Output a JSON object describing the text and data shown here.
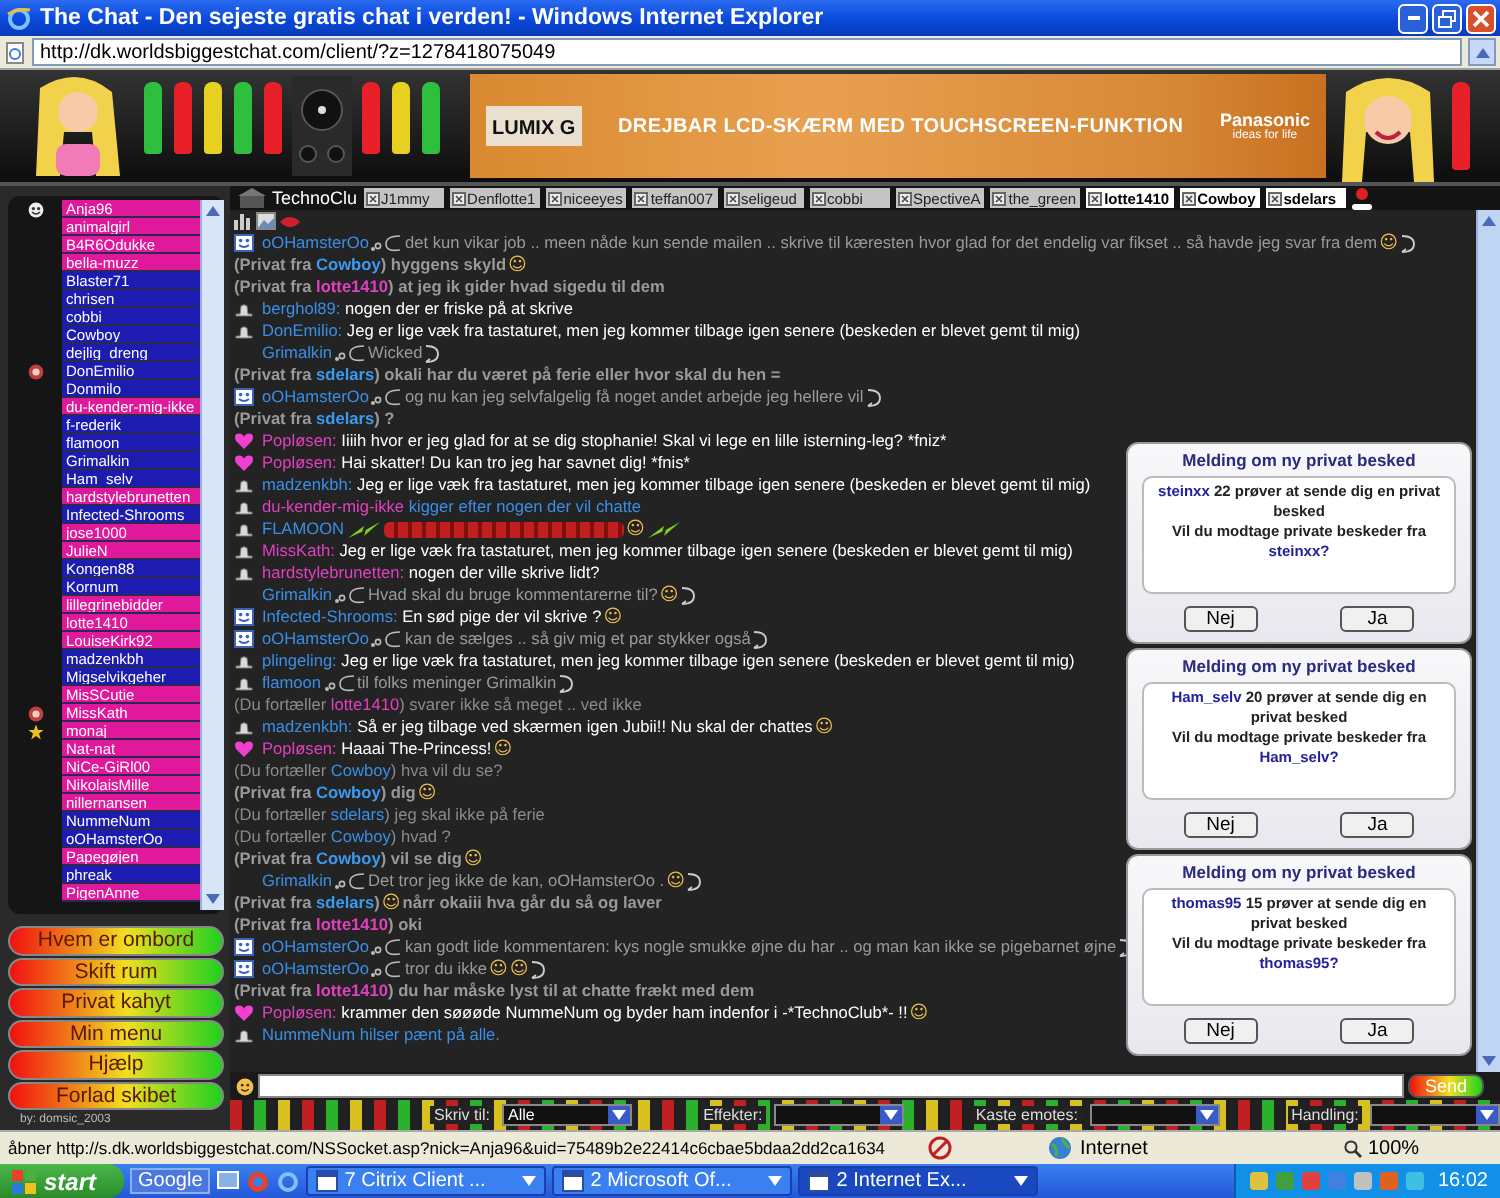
{
  "window": {
    "title": "The Chat - Den sejeste gratis chat i verden! - Windows Internet Explorer"
  },
  "address_bar": {
    "url": "http://dk.worldsbiggestchat.com/client/?z=1278418075049"
  },
  "banner": {
    "ad_brand": "LUMIX G",
    "ad_text": "DREJBAR LCD-SKÆRM MED TOUCHSCREEN-FUNKTION",
    "ad_maker": "Panasonic",
    "ad_slogan": "ideas for life"
  },
  "users": [
    {
      "name": "Anja96",
      "color": "#e0189c",
      "kind": "self"
    },
    {
      "name": "animalgirl",
      "color": "#e0189c",
      "kind": "plain"
    },
    {
      "name": "B4R6Odukke",
      "color": "#e0189c",
      "kind": "plain"
    },
    {
      "name": "bella-muzz",
      "color": "#e0189c",
      "kind": "plain"
    },
    {
      "name": "Blaster71",
      "color": "#1c1cb0",
      "kind": "plain"
    },
    {
      "name": "chrisen",
      "color": "#1c1cb0",
      "kind": "plain"
    },
    {
      "name": "cobbi",
      "color": "#1c1cb0",
      "kind": "plain"
    },
    {
      "name": "Cowboy",
      "color": "#1c1cb0",
      "kind": "plain"
    },
    {
      "name": "dejlig_dreng",
      "color": "#1c1cb0",
      "kind": "plain"
    },
    {
      "name": "DonEmilio",
      "color": "#1c1cb0",
      "kind": "face"
    },
    {
      "name": "Donmilo",
      "color": "#1c1cb0",
      "kind": "plain"
    },
    {
      "name": "du-kender-mig-ikke",
      "color": "#e0189c",
      "kind": "plain"
    },
    {
      "name": "f-rederik",
      "color": "#1c1cb0",
      "kind": "plain"
    },
    {
      "name": "flamoon",
      "color": "#1c1cb0",
      "kind": "plain"
    },
    {
      "name": "Grimalkin",
      "color": "#1c1cb0",
      "kind": "plain"
    },
    {
      "name": "Ham_selv",
      "color": "#1c1cb0",
      "kind": "plain"
    },
    {
      "name": "hardstylebrunetten",
      "color": "#e0189c",
      "kind": "plain"
    },
    {
      "name": "Infected-Shrooms",
      "color": "#1c1cb0",
      "kind": "plain"
    },
    {
      "name": "jose1000",
      "color": "#e0189c",
      "kind": "plain"
    },
    {
      "name": "JulieN",
      "color": "#e0189c",
      "kind": "plain"
    },
    {
      "name": "Kongen88",
      "color": "#1c1cb0",
      "kind": "plain"
    },
    {
      "name": "Kornum",
      "color": "#1c1cb0",
      "kind": "plain"
    },
    {
      "name": "lillegrinebidder",
      "color": "#e0189c",
      "kind": "plain"
    },
    {
      "name": "lotte1410",
      "color": "#e0189c",
      "kind": "plain"
    },
    {
      "name": "LouiseKirk92",
      "color": "#e0189c",
      "kind": "plain"
    },
    {
      "name": "madzenkbh",
      "color": "#1c1cb0",
      "kind": "plain"
    },
    {
      "name": "Migselvikgeher",
      "color": "#1c1cb0",
      "kind": "plain"
    },
    {
      "name": "MisSCutie",
      "color": "#e0189c",
      "kind": "plain"
    },
    {
      "name": "MissKath",
      "color": "#e0189c",
      "kind": "face"
    },
    {
      "name": "monaj",
      "color": "#e0189c",
      "kind": "star"
    },
    {
      "name": "Nat-nat",
      "color": "#e0189c",
      "kind": "plain"
    },
    {
      "name": "NiCe-GiRl00",
      "color": "#e0189c",
      "kind": "plain"
    },
    {
      "name": "NikolaisMille",
      "color": "#e0189c",
      "kind": "plain"
    },
    {
      "name": "nillernansen",
      "color": "#e0189c",
      "kind": "plain"
    },
    {
      "name": "NummeNum",
      "color": "#1c1cb0",
      "kind": "plain"
    },
    {
      "name": "oOHamsterOo",
      "color": "#1c1cb0",
      "kind": "plain"
    },
    {
      "name": "Papegøjen",
      "color": "#e0189c",
      "kind": "plain"
    },
    {
      "name": "phreak",
      "color": "#1c1cb0",
      "kind": "plain"
    },
    {
      "name": "PigenAnne",
      "color": "#e0189c",
      "kind": "plain"
    }
  ],
  "menu_buttons": [
    "Hvem er ombord",
    "Skift rum",
    "Privat kahyt",
    "Min menu",
    "Hjælp",
    "Forlad skibet"
  ],
  "credit": "by: domsic_2003",
  "tabs": {
    "room": "TechnoClu",
    "items": [
      {
        "label": "J1mmy",
        "highlighted": false
      },
      {
        "label": "Denflotte1",
        "highlighted": false
      },
      {
        "label": "niceeyes",
        "highlighted": false
      },
      {
        "label": "teffan007",
        "highlighted": false
      },
      {
        "label": "seligeud",
        "highlighted": false
      },
      {
        "label": "cobbi",
        "highlighted": false
      },
      {
        "label": "SpectiveA",
        "highlighted": false
      },
      {
        "label": "the_green",
        "highlighted": false
      },
      {
        "label": "lotte1410",
        "highlighted": true
      },
      {
        "label": "Cowboy",
        "highlighted": true
      },
      {
        "label": "sdelars",
        "highlighted": true
      }
    ]
  },
  "messages": [
    {
      "kind": "action",
      "vip": true,
      "name": "oOHamsterOo",
      "color": "#3a8ee6",
      "text": "det kun vikar job .. meen nåde kun sende mailen .. skrive til kæresten hvor glad for det endelig var fikset .. så havde jeg svar fra dem",
      "emotes": [
        "☺"
      ]
    },
    {
      "kind": "private",
      "before": "(Privat fra ",
      "name": "Cowboy",
      "color": "#3a9af0",
      "after": ") hyggens skyld",
      "emotes": [
        "☺"
      ]
    },
    {
      "kind": "private",
      "before": "(Privat fra ",
      "name": "lotte1410",
      "color": "#e040c0",
      "after": ") at jeg ik gider hvad sigedu til dem"
    },
    {
      "kind": "public",
      "member": true,
      "name": "berghol89:",
      "color": "#3a8ee6",
      "text": " nogen der er friske på at skrive"
    },
    {
      "kind": "public",
      "member": true,
      "name": "DonEmilio:",
      "color": "#3a8ee6",
      "text": " Jeg er lige væk fra tastaturet, men jeg kommer tilbage igen senere (beskeden er blevet gemt til mig)"
    },
    {
      "kind": "action",
      "name": "Grimalkin",
      "color": "#3a8ee6",
      "text": "Wicked"
    },
    {
      "kind": "private",
      "before": "(Privat fra ",
      "name": "sdelars",
      "color": "#3a9af0",
      "after": ") okali har du været på ferie eller hvor skal du hen ="
    },
    {
      "kind": "action",
      "vip": true,
      "name": "oOHamsterOo",
      "color": "#3a8ee6",
      "text": "og nu kan jeg selvfalgelig få noget andet arbejde jeg hellere vil"
    },
    {
      "kind": "private",
      "before": "(Privat fra ",
      "name": "sdelars",
      "color": "#3a9af0",
      "after": ") ?"
    },
    {
      "kind": "public",
      "favorite": true,
      "name": "Popløsen:",
      "color": "#e040c0",
      "text": " Iiiih hvor er jeg glad for at se dig stophanie! Skal vi lege en lille isterning-leg? *fniz*"
    },
    {
      "kind": "public",
      "favorite": true,
      "name": "Popløsen:",
      "color": "#e040c0",
      "text": " Hai skatter! Du kan tro jeg har savnet dig! *fnis*"
    },
    {
      "kind": "public",
      "member": true,
      "name": "madzenkbh:",
      "color": "#3a8ee6",
      "text": " Jeg er lige væk fra tastaturet, men jeg kommer tilbage igen senere (beskeden er blevet gemt til mig)"
    },
    {
      "kind": "status",
      "member": true,
      "name": "du-kender-mig-ikke",
      "color": "#e040c0",
      "text": " kigger efter nogen der vil chatte"
    },
    {
      "kind": "effect",
      "member": true,
      "name": "FLAMOON",
      "color": "#3a8ee6",
      "emotes": [
        "☺"
      ]
    },
    {
      "kind": "public",
      "member": true,
      "name": "MissKath:",
      "color": "#e040c0",
      "text": " Jeg er lige væk fra tastaturet, men jeg kommer tilbage igen senere (beskeden er blevet gemt til mig)"
    },
    {
      "kind": "public",
      "member": true,
      "name": "hardstylebrunetten:",
      "color": "#e040c0",
      "text": " nogen der ville skrive lidt?"
    },
    {
      "kind": "action",
      "name": "Grimalkin",
      "color": "#3a8ee6",
      "text": "Hvad skal du bruge kommentarerne til?",
      "emotes": [
        "☺"
      ]
    },
    {
      "kind": "public",
      "vip": true,
      "name": "Infected-Shrooms:",
      "color": "#3a8ee6",
      "text": " En sød pige der vil skrive ?",
      "emotes": [
        "☺"
      ]
    },
    {
      "kind": "action",
      "vip": true,
      "name": "oOHamsterOo",
      "color": "#3a8ee6",
      "text": "kan de sælges .. så giv mig et par stykker også"
    },
    {
      "kind": "public",
      "member": true,
      "name": "plingeling:",
      "color": "#3a8ee6",
      "text": " Jeg er lige væk fra tastaturet, men jeg kommer tilbage igen senere (beskeden er blevet gemt til mig)"
    },
    {
      "kind": "action",
      "member": true,
      "name": "flamoon",
      "color": "#3a8ee6",
      "text": "til folks meninger Grimalkin"
    },
    {
      "kind": "told",
      "before": "(Du fortæller ",
      "name": "lotte1410",
      "color": "#e040c0",
      "after": ") svarer ikke så meget .. ved ikke"
    },
    {
      "kind": "public",
      "member": true,
      "name": "madzenkbh:",
      "color": "#3a8ee6",
      "text": " Så er jeg tilbage ved skærmen igen Jubii!! Nu skal der chattes",
      "emotes": [
        "☺"
      ]
    },
    {
      "kind": "public",
      "favorite": true,
      "name": "Popløsen:",
      "color": "#e040c0",
      "text": " Haaai The-Princess!",
      "emotes": [
        "☺"
      ]
    },
    {
      "kind": "told",
      "before": "(Du fortæller ",
      "name": "Cowboy",
      "color": "#3a8ee6",
      "after": ") hva vil du se?"
    },
    {
      "kind": "private",
      "before": "(Privat fra ",
      "name": "Cowboy",
      "color": "#3a9af0",
      "after": ") dig",
      "emotes": [
        "☺"
      ]
    },
    {
      "kind": "told",
      "before": "(Du fortæller ",
      "name": "sdelars",
      "color": "#3a8ee6",
      "after": ") jeg skal ikke på ferie"
    },
    {
      "kind": "told",
      "before": "(Du fortæller ",
      "name": "Cowboy",
      "color": "#3a8ee6",
      "after": ") hvad ?"
    },
    {
      "kind": "private",
      "before": "(Privat fra ",
      "name": "Cowboy",
      "color": "#3a9af0",
      "after": ") vil se dig",
      "emotes": [
        "☺"
      ]
    },
    {
      "kind": "action",
      "name": "Grimalkin",
      "color": "#3a8ee6",
      "text": "Det tror jeg ikke de kan, oOHamsterOo .",
      "emotes": [
        "☺"
      ]
    },
    {
      "kind": "private",
      "before": "(Privat fra ",
      "name": "sdelars",
      "color": "#3a9af0",
      "after": ")",
      "emotes": [
        "☺"
      ],
      "tail": "nårr okaiii hva går du så og laver"
    },
    {
      "kind": "private",
      "before": "(Privat fra ",
      "name": "lotte1410",
      "color": "#e040c0",
      "after": ") oki"
    },
    {
      "kind": "action",
      "vip": true,
      "name": "oOHamsterOo",
      "color": "#3a8ee6",
      "text": "kan godt lide kommentaren: kys nogle smukke øjne du har .. og man kan ikke se pigebarnet øjne"
    },
    {
      "kind": "action",
      "vip": true,
      "name": "oOHamsterOo",
      "color": "#3a8ee6",
      "text": "tror du ikke",
      "emotes": [
        "☺",
        "☺"
      ]
    },
    {
      "kind": "private",
      "before": "(Privat fra ",
      "name": "lotte1410",
      "color": "#e040c0",
      "after": ") du har måske lyst til at chatte frækt med dem"
    },
    {
      "kind": "public",
      "favorite": true,
      "name": "Popløsen:",
      "color": "#e040c0",
      "text": " krammer den søøøde NummeNum og byder ham indenfor i -*TechnoClub*- !!",
      "emotes": [
        "☺"
      ]
    },
    {
      "kind": "status",
      "member": true,
      "name": "NummeNum",
      "color": "#3a8ee6",
      "text": " hilser pænt på alle."
    }
  ],
  "popups": [
    {
      "title": "Melding om ny privat besked",
      "sender": "steinxx",
      "text": " 22 prøver at sende dig en privat besked",
      "question": "Vil du modtage private beskeder fra ",
      "sender_again": "steinxx?",
      "buttons": [
        "Nej",
        "Ja"
      ]
    },
    {
      "title": "Melding om ny privat besked",
      "sender": "Ham_selv",
      "text": " 20 prøver at sende dig en privat besked",
      "question": "Vil du modtage private beskeder fra ",
      "sender_again": "Ham_selv?",
      "buttons": [
        "Nej",
        "Ja"
      ]
    },
    {
      "title": "Melding om ny privat besked",
      "sender": "thomas95",
      "text": " 15 prøver at sende dig en privat besked",
      "question": "Vil du modtage private beskeder fra ",
      "sender_again": "thomas95?",
      "buttons": [
        "Nej",
        "Ja"
      ]
    }
  ],
  "composer": {
    "send": "Send"
  },
  "options": [
    {
      "label": "Skriv til:",
      "value": "Alle"
    },
    {
      "label": "Effekter:"
    },
    {
      "label": "Kaste emotes:"
    },
    {
      "label": "Handling:"
    }
  ],
  "status_bar": {
    "text": "åbner http://s.dk.worldsbiggestchat.com/NSSocket.asp?nick=Anja96&uid=75489b2e22414c6cbae5bdaa2dd2ca1634",
    "zone": "Internet",
    "zoom": "100%"
  },
  "taskbar": {
    "start": "start",
    "search": "Google",
    "tasks": [
      {
        "label": "7 Citrix Client ...",
        "selected": false
      },
      {
        "label": "2 Microsoft Of...",
        "selected": false
      },
      {
        "label": "2 Internet Ex...",
        "selected": true
      }
    ],
    "clock": "16:02"
  }
}
